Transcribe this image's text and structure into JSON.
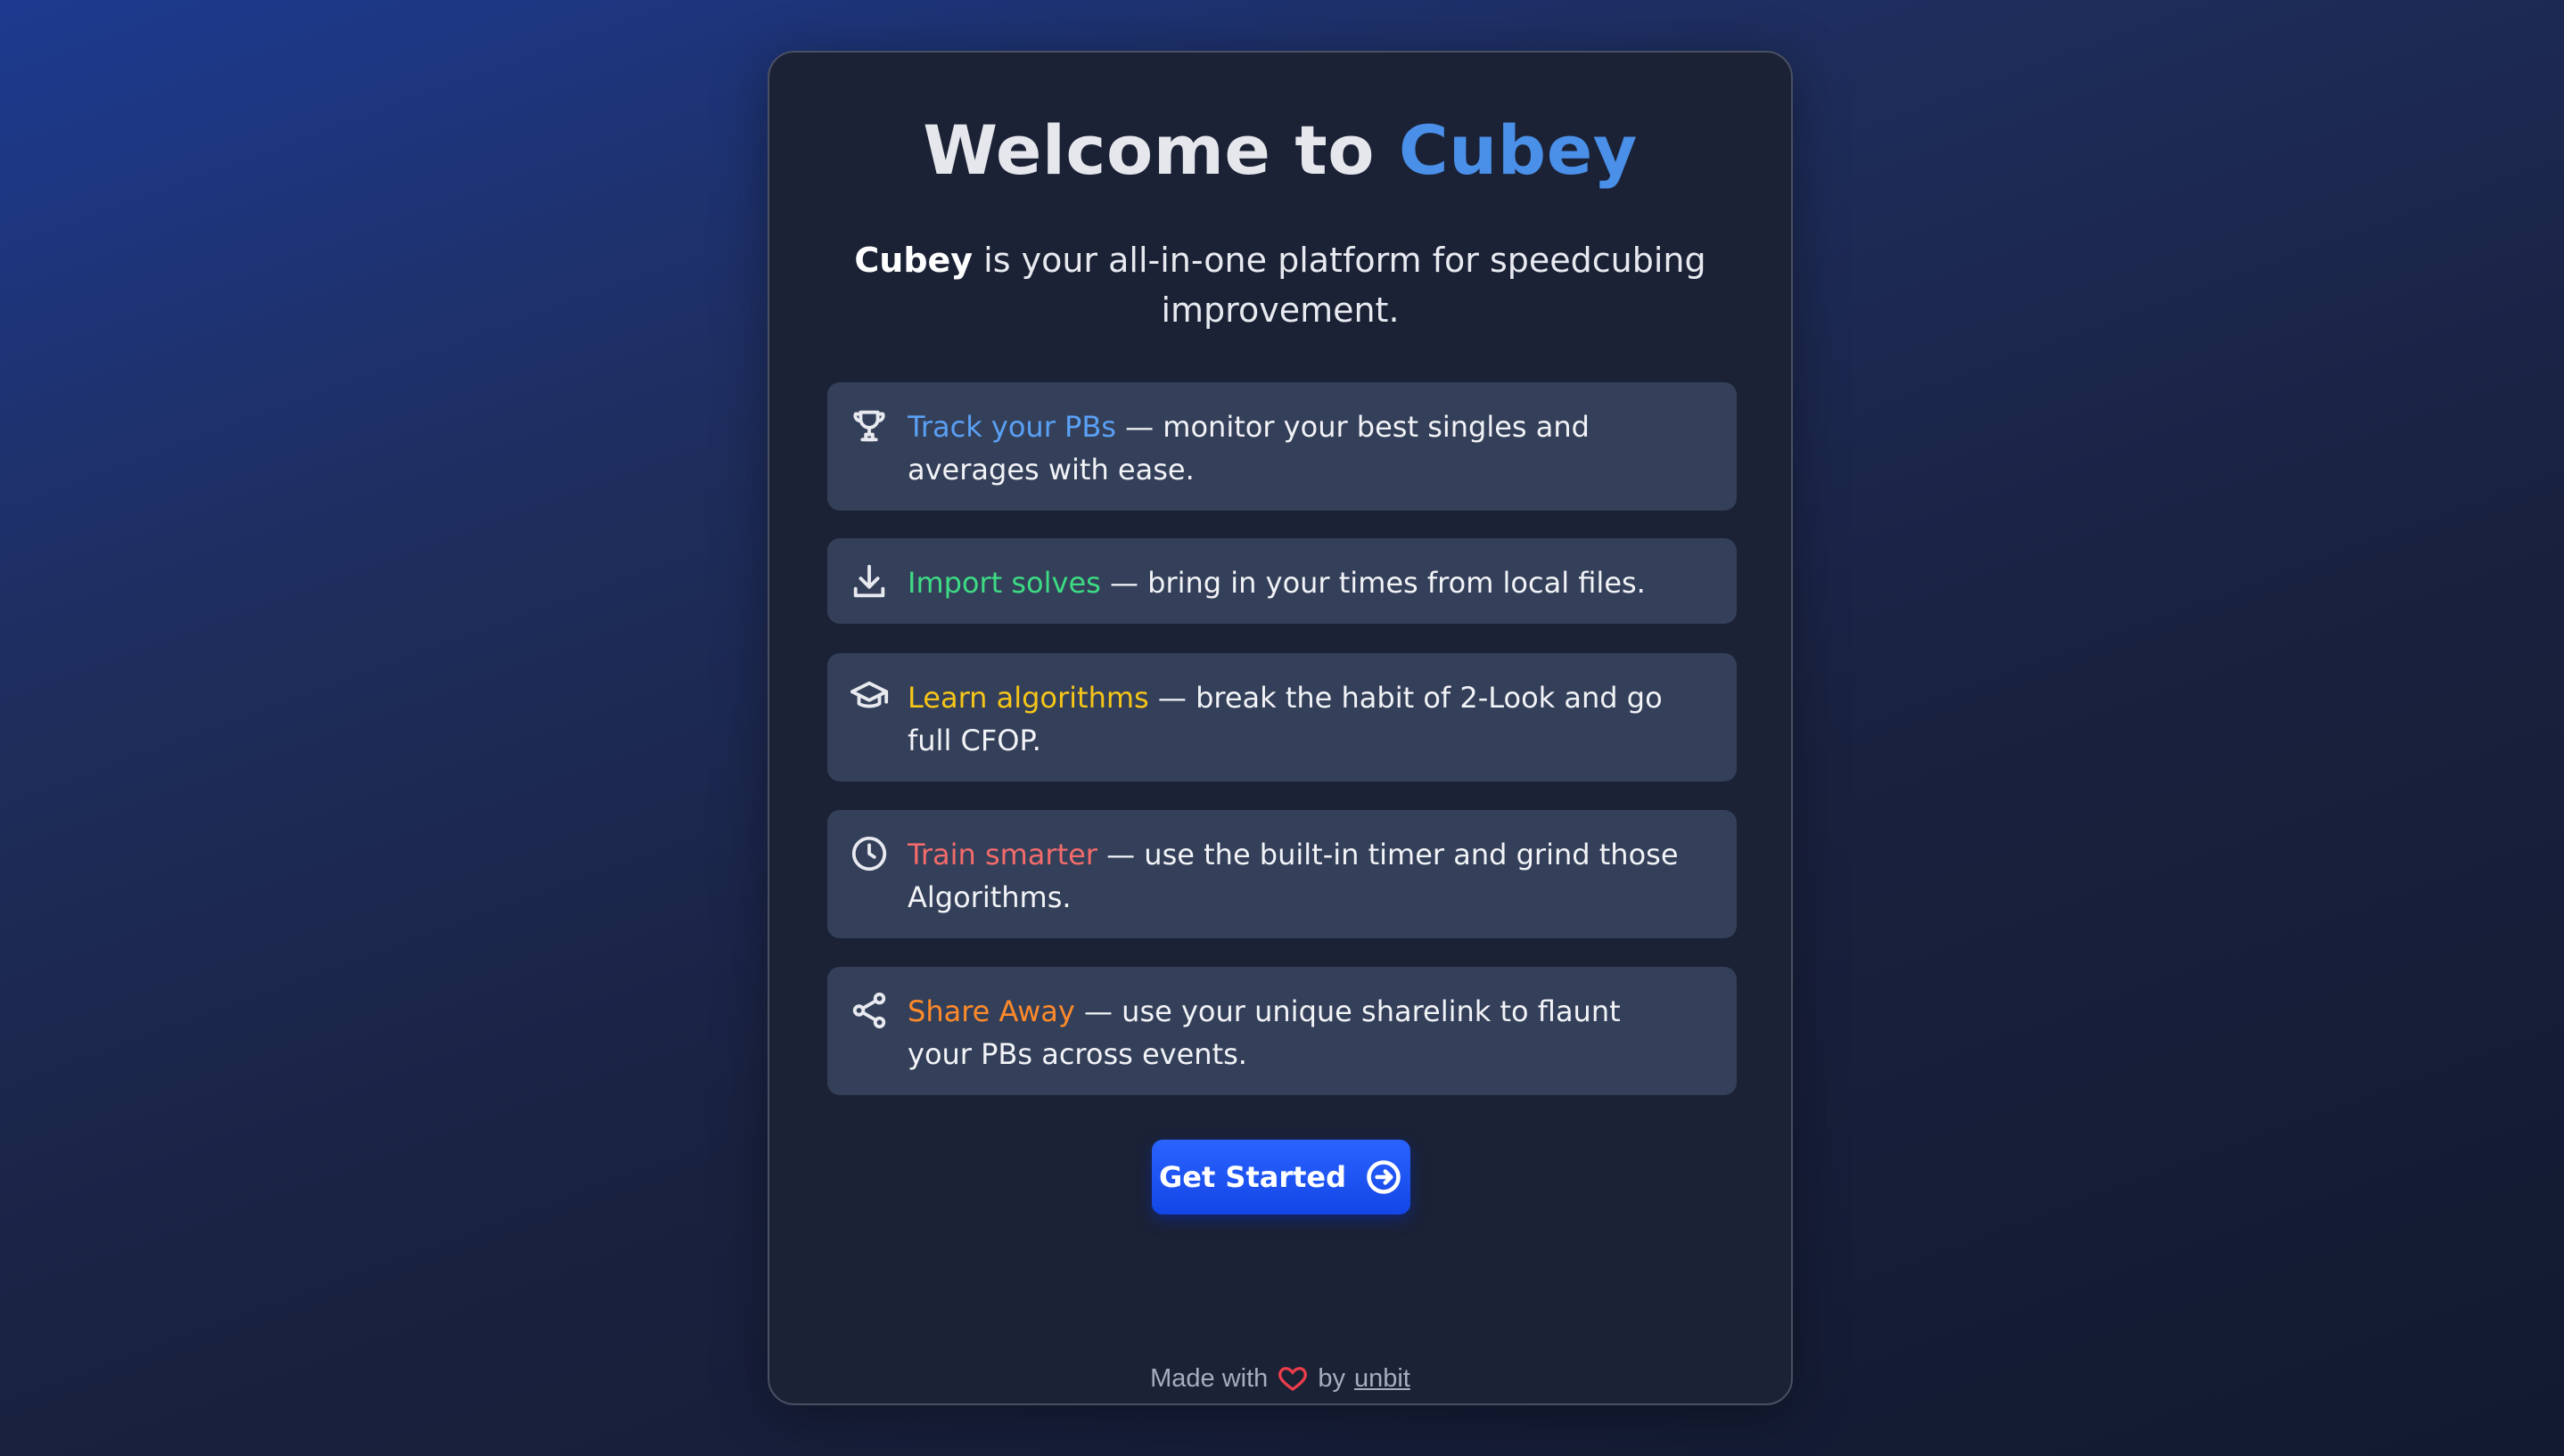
{
  "header": {
    "title_prefix": "Welcome to ",
    "title_brand": "Cubey"
  },
  "intro": {
    "brand": "Cubey",
    "text": " is your all-in-one platform for speedcubing improvement."
  },
  "features": [
    {
      "icon": "trophy-icon",
      "highlight": "Track your PBs",
      "color": "#5aa0f5",
      "text": " — monitor your best singles and averages with ease."
    },
    {
      "icon": "download-icon",
      "highlight": "Import solves",
      "color": "#3ddc84",
      "text": " — bring in your times from local files."
    },
    {
      "icon": "graduation-cap-icon",
      "highlight": "Learn algorithms",
      "color": "#f5c518",
      "text": " — break the habit of 2-Look and go full CFOP."
    },
    {
      "icon": "clock-icon",
      "highlight": "Train smarter",
      "color": "#f36b6b",
      "text": " — use the built-in timer and grind those Algorithms."
    },
    {
      "icon": "share-icon",
      "highlight": "Share Away",
      "color": "#ff8a2a",
      "text": " — use your unique sharelink to flaunt your PBs across events."
    }
  ],
  "cta": {
    "label": "Get Started",
    "icon": "arrow-right-circle-icon",
    "color": "#1d55ff"
  },
  "footer": {
    "made_with": "Made with",
    "icon": "heart-icon",
    "by": "by",
    "author": "unbit"
  }
}
